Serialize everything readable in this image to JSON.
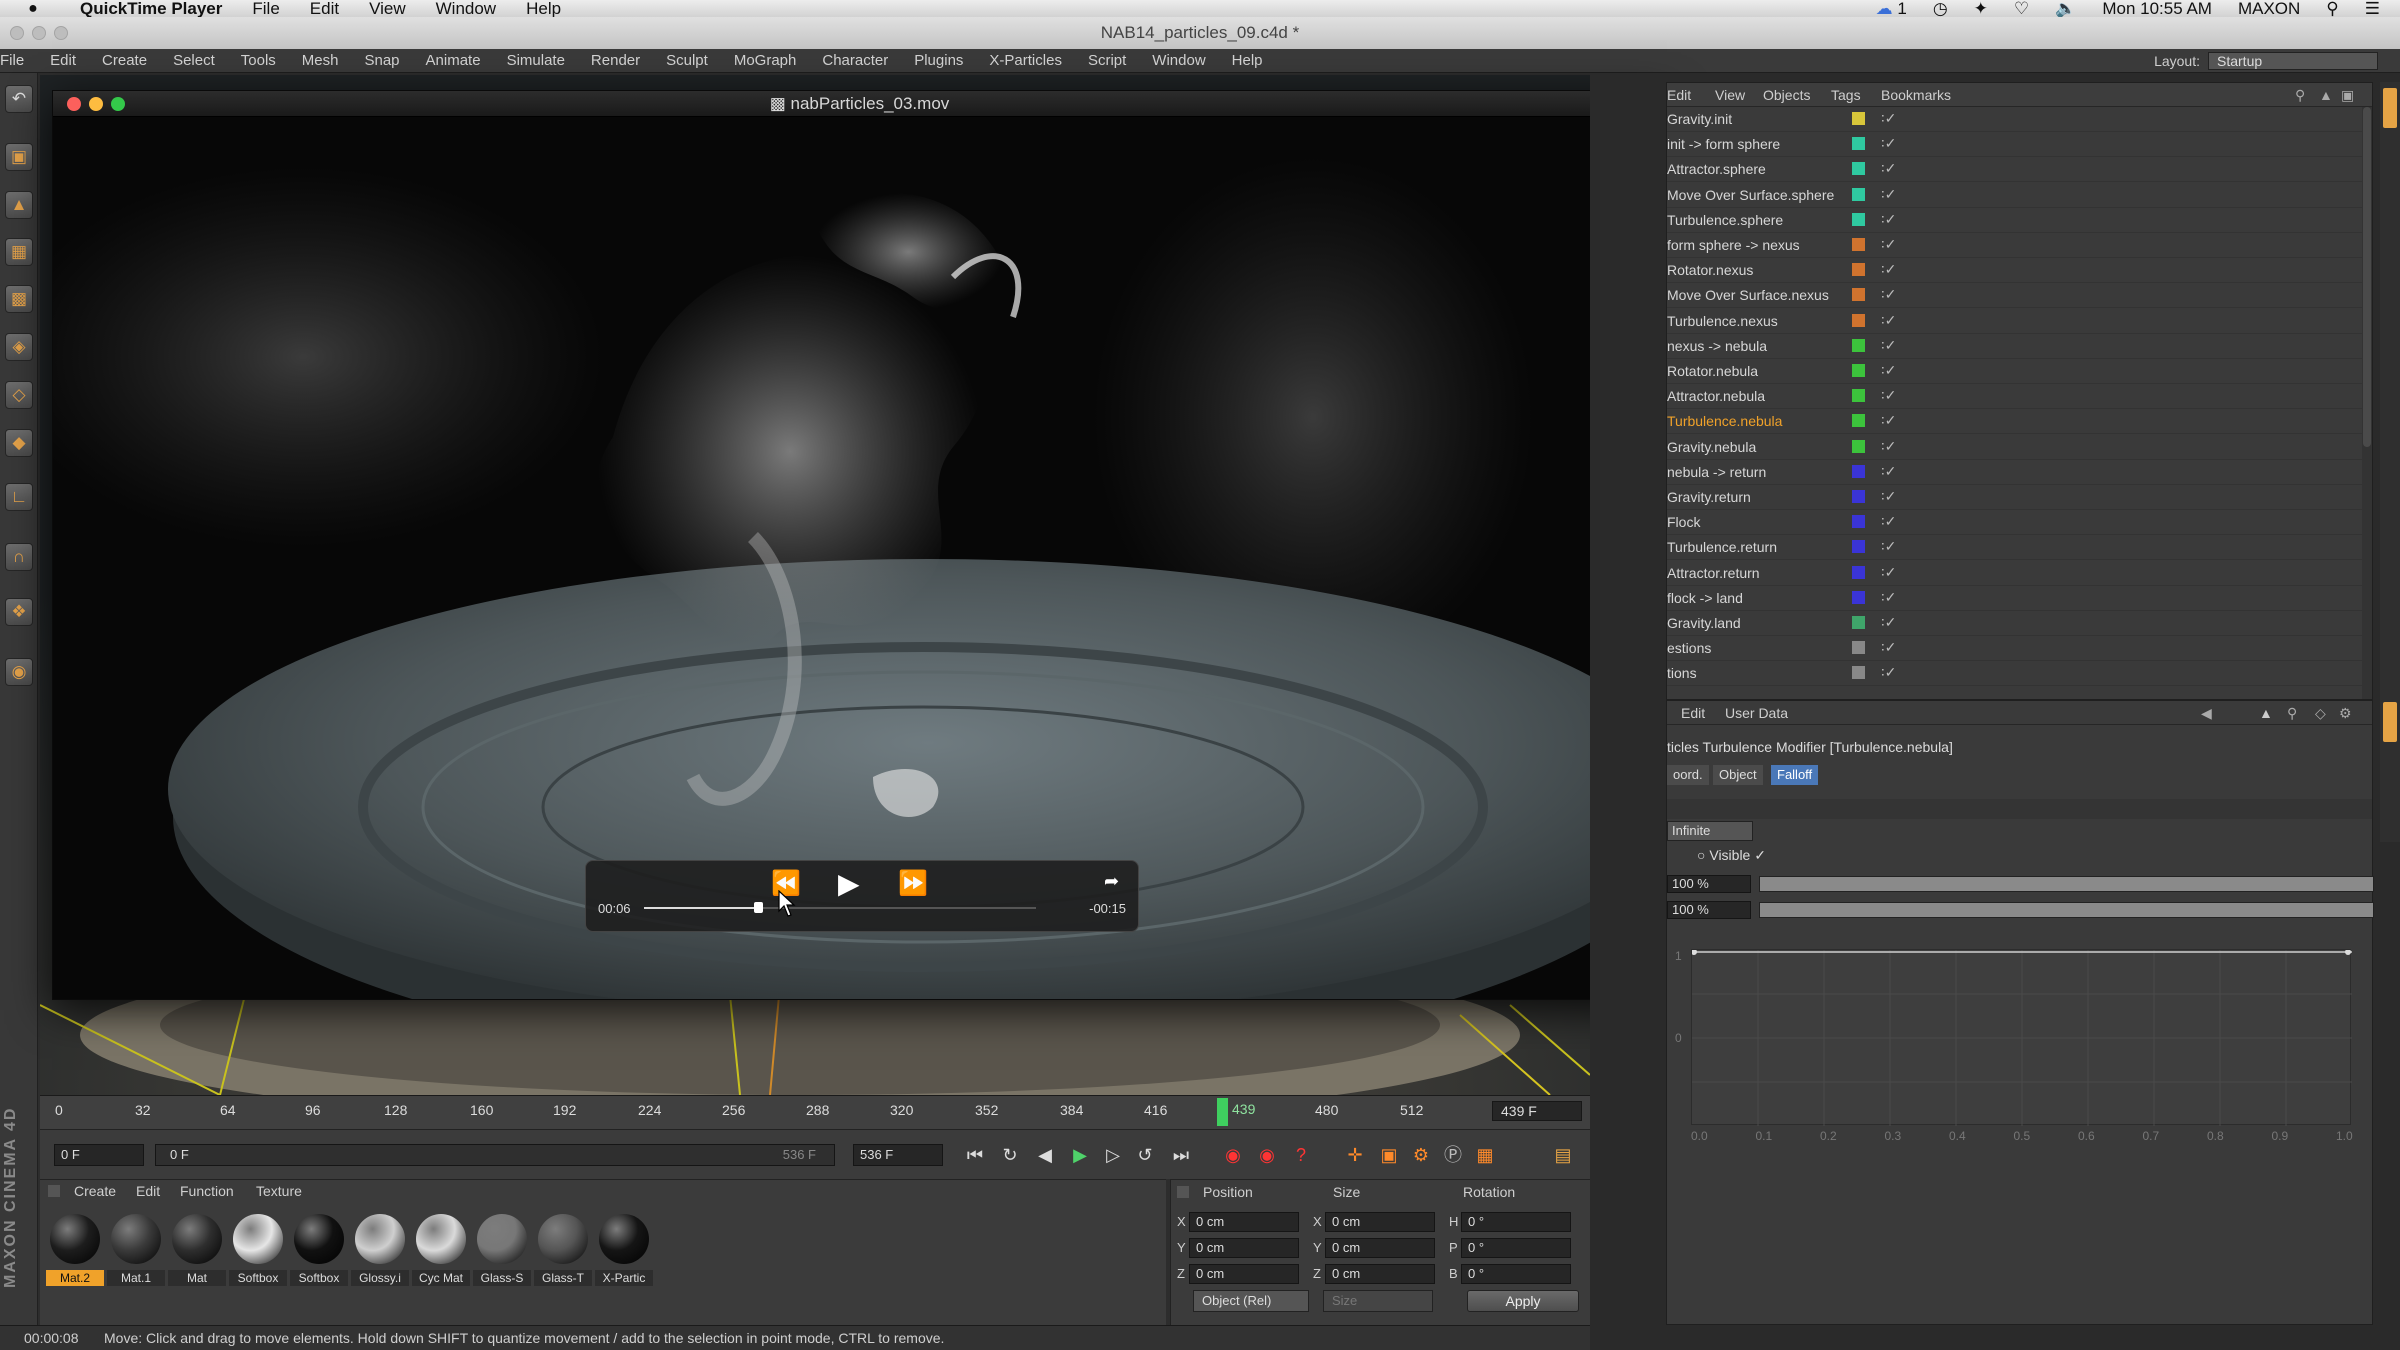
{
  "mac_menubar": {
    "app_name": "QuickTime Player",
    "menus": [
      "File",
      "Edit",
      "View",
      "Window",
      "Help"
    ],
    "right_badge": "1",
    "clock": "Mon 10:55 AM",
    "user": "MAXON"
  },
  "c4d_window_title": "NAB14_particles_09.c4d *",
  "c4d_menu": [
    "File",
    "Edit",
    "Create",
    "Select",
    "Tools",
    "Mesh",
    "Snap",
    "Animate",
    "Simulate",
    "Render",
    "Sculpt",
    "MoGraph",
    "Character",
    "Plugins",
    "X-Particles",
    "Script",
    "Window",
    "Help"
  ],
  "layout": {
    "label": "Layout:",
    "value": "Startup"
  },
  "quicktime": {
    "title": "nabParticles_03.mov",
    "elapsed": "00:06",
    "remaining": "-00:15",
    "progress": 0.29
  },
  "timeline": {
    "ticks": [
      "0",
      "32",
      "64",
      "96",
      "128",
      "160",
      "192",
      "224",
      "256",
      "288",
      "320",
      "352",
      "384",
      "416",
      "480",
      "512"
    ],
    "current_frame": "439",
    "end_frame": "439 F"
  },
  "transport": {
    "start_field": "0 F",
    "range_start": "0 F",
    "range_end": "536 F",
    "end_field": "536 F"
  },
  "material_menu": [
    "Create",
    "Edit",
    "Function",
    "Texture"
  ],
  "materials": [
    {
      "name": "Mat.2",
      "selected": true,
      "color": "#1d1d1d"
    },
    {
      "name": "Mat.1",
      "selected": false,
      "color": "#3a3a3a"
    },
    {
      "name": "Mat",
      "selected": false,
      "color": "#2e2e2e"
    },
    {
      "name": "Softbox",
      "selected": false,
      "color": "#e6e6e6"
    },
    {
      "name": "Softbox",
      "selected": false,
      "color": "#111111"
    },
    {
      "name": "Glossy.i",
      "selected": false,
      "color": "#cfcfcf"
    },
    {
      "name": "Cyc Mat",
      "selected": false,
      "color": "#dadada"
    },
    {
      "name": "Glass-S",
      "selected": false,
      "color": "#777777"
    },
    {
      "name": "Glass-T",
      "selected": false,
      "color": "#555555"
    },
    {
      "name": "X-Partic",
      "selected": false,
      "color": "#151515"
    }
  ],
  "coords": {
    "headers": [
      "Position",
      "Size",
      "Rotation"
    ],
    "rows": [
      {
        "axis": "X",
        "pos": "0 cm",
        "size_axis": "X",
        "size": "0 cm",
        "rot_axis": "H",
        "rot": "0 °"
      },
      {
        "axis": "Y",
        "pos": "0 cm",
        "size_axis": "Y",
        "size": "0 cm",
        "rot_axis": "P",
        "rot": "0 °"
      },
      {
        "axis": "Z",
        "pos": "0 cm",
        "size_axis": "Z",
        "size": "0 cm",
        "rot_axis": "B",
        "rot": "0 °"
      }
    ],
    "mode": "Object (Rel)",
    "size_mode": "Size",
    "apply": "Apply"
  },
  "status": {
    "time": "00:00:08",
    "message": "Move: Click and drag to move elements. Hold down SHIFT to quantize movement / add to the selection in point mode, CTRL to remove."
  },
  "object_manager": {
    "menu": [
      "Edit",
      "View",
      "Objects",
      "Tags",
      "Bookmarks"
    ],
    "objects": [
      {
        "name": "Gravity.init",
        "color": "#d8c63a",
        "selected": false
      },
      {
        "name": "init -> form sphere",
        "color": "#2fc9a0",
        "selected": false
      },
      {
        "name": "Attractor.sphere",
        "color": "#2fc9a0",
        "selected": false
      },
      {
        "name": "Move Over Surface.sphere",
        "color": "#2fc9a0",
        "selected": false
      },
      {
        "name": "Turbulence.sphere",
        "color": "#2fc9a0",
        "selected": false
      },
      {
        "name": "form sphere -> nexus",
        "color": "#d0732e",
        "selected": false
      },
      {
        "name": "Rotator.nexus",
        "color": "#d0732e",
        "selected": false
      },
      {
        "name": "Move Over Surface.nexus",
        "color": "#d0732e",
        "selected": false
      },
      {
        "name": "Turbulence.nexus",
        "color": "#d0732e",
        "selected": false
      },
      {
        "name": "nexus -> nebula",
        "color": "#3cc33c",
        "selected": false
      },
      {
        "name": "Rotator.nebula",
        "color": "#3cc33c",
        "selected": false
      },
      {
        "name": "Attractor.nebula",
        "color": "#3cc33c",
        "selected": false
      },
      {
        "name": "Turbulence.nebula",
        "color": "#3cc33c",
        "selected": true
      },
      {
        "name": "Gravity.nebula",
        "color": "#3cc33c",
        "selected": false
      },
      {
        "name": "nebula -> return",
        "color": "#3a34d6",
        "selected": false
      },
      {
        "name": "Gravity.return",
        "color": "#3a34d6",
        "selected": false
      },
      {
        "name": "Flock",
        "color": "#3a34d6",
        "selected": false
      },
      {
        "name": "Turbulence.return",
        "color": "#3a34d6",
        "selected": false
      },
      {
        "name": "Attractor.return",
        "color": "#3a34d6",
        "selected": false
      },
      {
        "name": "flock -> land",
        "color": "#3a34d6",
        "selected": false
      },
      {
        "name": "Gravity.land",
        "color": "#3fa56a",
        "selected": false
      },
      {
        "name": "estions",
        "color": "#888888",
        "selected": false
      },
      {
        "name": "tions",
        "color": "#888888",
        "selected": false
      }
    ]
  },
  "attribute_manager": {
    "menu": [
      "Edit",
      "User Data"
    ],
    "title": "ticles Turbulence Modifier [Turbulence.nebula]",
    "tabs": [
      {
        "label": "oord.",
        "active": false
      },
      {
        "label": "Object",
        "active": false
      },
      {
        "label": "Falloff",
        "active": true
      }
    ],
    "shape": "Infinite",
    "visible_label": "Visible",
    "strength_1": "100 %",
    "strength_2": "100 %",
    "graph_x_ticks": [
      "0.0",
      "0.1",
      "0.2",
      "0.3",
      "0.4",
      "0.5",
      "0.6",
      "0.7",
      "0.8",
      "0.9",
      "1.0"
    ],
    "graph_y_ticks": [
      "1",
      "0"
    ]
  }
}
